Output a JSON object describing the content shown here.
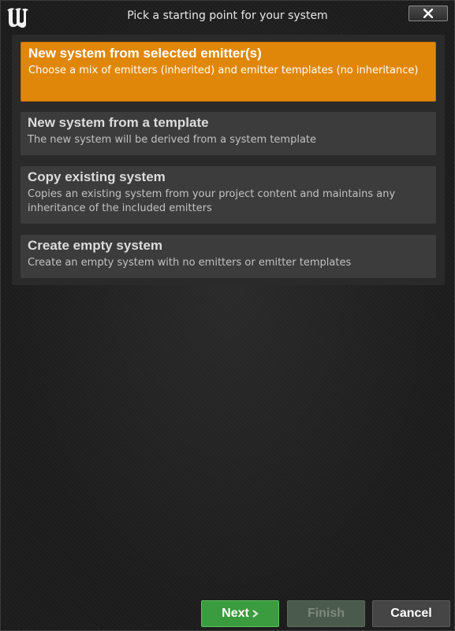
{
  "window": {
    "title": "Pick a starting point for your system",
    "logo_icon": "unreal-engine-logo-icon",
    "close_icon": "close-icon"
  },
  "options": [
    {
      "title": "New system from selected emitter(s)",
      "description": "Choose a mix of emitters (inherited) and emitter templates (no inheritance)",
      "selected": true
    },
    {
      "title": "New system from a template",
      "description": "The new system will be derived from a system template",
      "selected": false
    },
    {
      "title": "Copy existing system",
      "description": "Copies an existing system from your project content and maintains any inheritance of the included emitters",
      "selected": false
    },
    {
      "title": "Create empty system",
      "description": "Create an empty system with no emitters or emitter templates",
      "selected": false
    }
  ],
  "footer": {
    "next_label": "Next",
    "next_icon": "chevron-right-icon",
    "finish_label": "Finish",
    "cancel_label": "Cancel"
  },
  "colors": {
    "selected_accent": "#e0870a",
    "next_button": "#3a9c3e"
  }
}
